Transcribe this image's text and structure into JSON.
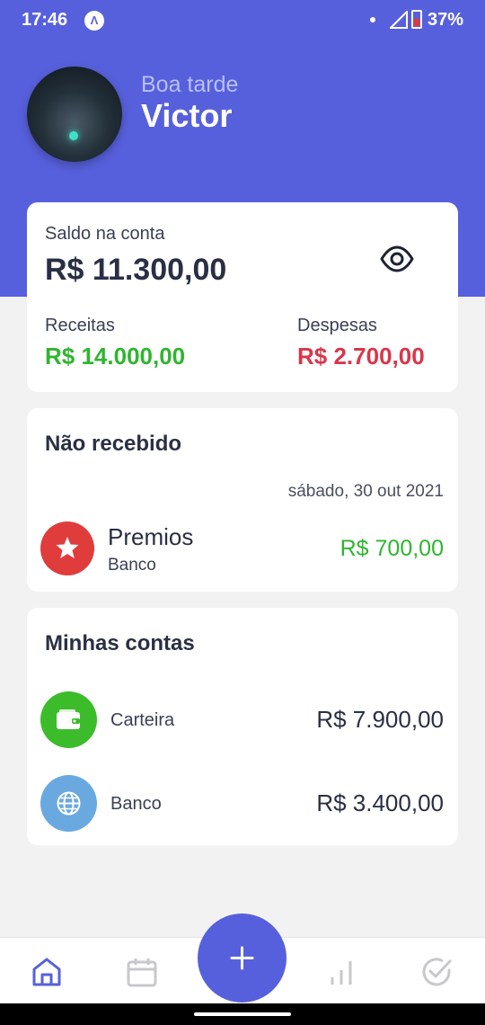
{
  "status_bar": {
    "time": "17:46",
    "app_glyph": "Λ",
    "battery_percent": "37%"
  },
  "greeting": {
    "subtitle": "Boa tarde",
    "name": "Victor"
  },
  "balance": {
    "label": "Saldo na conta",
    "value": "R$ 11.300,00",
    "income_label": "Receitas",
    "income_value": "R$ 14.000,00",
    "expense_label": "Despesas",
    "expense_value": "R$ 2.700,00"
  },
  "pending": {
    "title": "Não recebido",
    "date": "sábado, 30 out 2021",
    "item": {
      "name": "Premios",
      "source": "Banco",
      "amount": "R$ 700,00",
      "icon": "star-icon"
    }
  },
  "accounts": {
    "title": "Minhas contas",
    "items": [
      {
        "name": "Carteira",
        "amount": "R$ 7.900,00",
        "icon": "wallet-icon",
        "color": "#3cbc2a"
      },
      {
        "name": "Banco",
        "amount": "R$ 3.400,00",
        "icon": "globe-icon",
        "color": "#6aa9df"
      }
    ]
  },
  "bottom_nav": {
    "items": [
      "home-icon",
      "calendar-icon",
      "add-icon",
      "chart-icon",
      "check-circle-icon"
    ],
    "active": "home-icon"
  },
  "colors": {
    "primary": "#5760dc",
    "income": "#2fb52f",
    "expense": "#d9364a",
    "background": "#f2f2f2"
  }
}
